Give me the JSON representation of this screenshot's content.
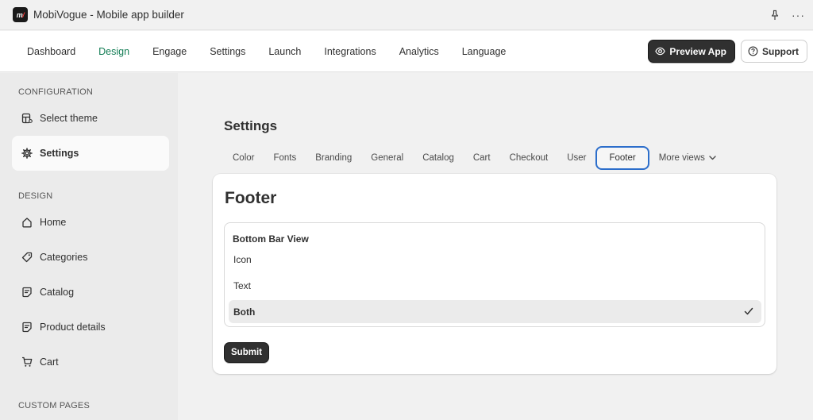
{
  "window": {
    "app_logo_text": "m",
    "title": "MobiVogue - Mobile app builder",
    "pin_icon": "pin-icon",
    "more_icon": "ellipsis-icon",
    "more_glyph": "···"
  },
  "topnav": {
    "items": [
      {
        "label": "Dashboard",
        "active": false
      },
      {
        "label": "Design",
        "active": true
      },
      {
        "label": "Engage",
        "active": false
      },
      {
        "label": "Settings",
        "active": false
      },
      {
        "label": "Launch",
        "active": false
      },
      {
        "label": "Integrations",
        "active": false
      },
      {
        "label": "Analytics",
        "active": false
      },
      {
        "label": "Language",
        "active": false
      }
    ],
    "preview_label": "Preview App",
    "support_label": "Support"
  },
  "sidebar": {
    "configuration_title": "CONFIGURATION",
    "config_items": [
      {
        "label": "Select theme",
        "icon": "theme-icon",
        "active": false
      },
      {
        "label": "Settings",
        "icon": "gear-icon",
        "active": true
      }
    ],
    "design_title": "DESIGN",
    "design_items": [
      {
        "label": "Home",
        "icon": "home-icon"
      },
      {
        "label": "Categories",
        "icon": "tag-icon"
      },
      {
        "label": "Catalog",
        "icon": "note-icon"
      },
      {
        "label": "Product details",
        "icon": "note-icon"
      },
      {
        "label": "Cart",
        "icon": "cart-icon"
      }
    ],
    "custom_pages_title": "CUSTOM PAGES"
  },
  "main": {
    "title": "Settings",
    "tabs": [
      {
        "label": "Color",
        "active": false
      },
      {
        "label": "Fonts",
        "active": false
      },
      {
        "label": "Branding",
        "active": false
      },
      {
        "label": "General",
        "active": false
      },
      {
        "label": "Catalog",
        "active": false
      },
      {
        "label": "Cart",
        "active": false
      },
      {
        "label": "Checkout",
        "active": false
      },
      {
        "label": "User",
        "active": false
      },
      {
        "label": "Footer",
        "active": true
      }
    ],
    "more_views_label": "More views",
    "card": {
      "title": "Footer",
      "listbox_title": "Bottom Bar View",
      "options": [
        {
          "label": "Icon",
          "selected": false
        },
        {
          "label": "Text",
          "selected": false
        },
        {
          "label": "Both",
          "selected": true
        }
      ],
      "submit_label": "Submit"
    }
  },
  "colors": {
    "accent_green": "#137d55",
    "focus_blue": "#2c6ecb",
    "primary_button": "#303030"
  }
}
